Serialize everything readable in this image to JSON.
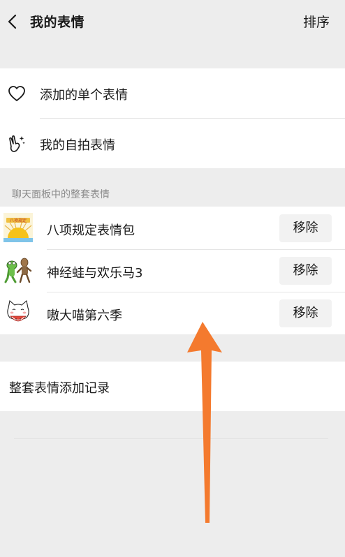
{
  "header": {
    "title": "我的表情",
    "sort_label": "排序"
  },
  "personal": {
    "items": [
      {
        "label": "添加的单个表情",
        "icon": "heart-outline-icon"
      },
      {
        "label": "我的自拍表情",
        "icon": "victory-hand-icon"
      }
    ]
  },
  "sets": {
    "section_label": "聊天面板中的整套表情",
    "remove_label": "移除",
    "items": [
      {
        "name": "八项规定表情包",
        "thumb_text": "八项规定",
        "icon": "sun-sticker-thumbnail"
      },
      {
        "name": "神经蛙与欢乐马3",
        "icon": "frog-horse-sticker-thumbnail"
      },
      {
        "name": "嗷大喵第六季",
        "icon": "cat-sticker-thumbnail"
      }
    ]
  },
  "history": {
    "label": "整套表情添加记录"
  },
  "colors": {
    "accent_arrow": "#f47a2e",
    "background": "#ededed",
    "card": "#ffffff",
    "button": "#f2f2f2"
  }
}
